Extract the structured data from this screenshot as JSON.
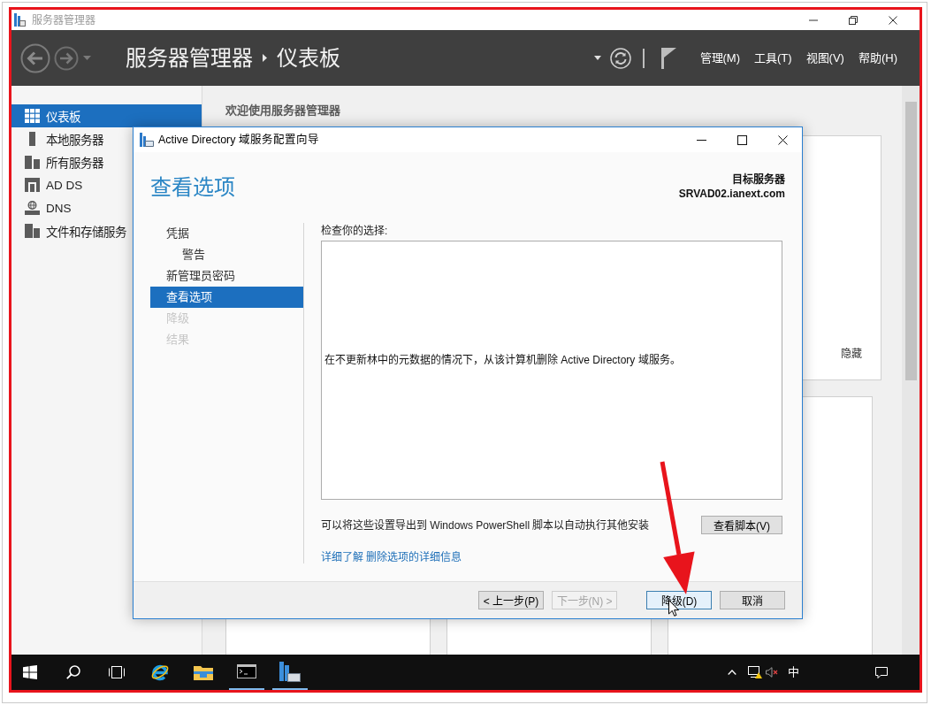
{
  "window": {
    "title": "服务器管理器"
  },
  "header": {
    "breadcrumb": [
      {
        "label": "服务器管理器"
      },
      {
        "label": "仪表板"
      }
    ],
    "menus": [
      "管理(M)",
      "工具(T)",
      "视图(V)",
      "帮助(H)"
    ]
  },
  "sidebar": {
    "items": [
      {
        "label": "仪表板",
        "selected": true
      },
      {
        "label": "本地服务器",
        "selected": false
      },
      {
        "label": "所有服务器",
        "selected": false
      },
      {
        "label": "AD DS",
        "selected": false
      },
      {
        "label": "DNS",
        "selected": false
      },
      {
        "label": "文件和存储服务",
        "selected": false
      }
    ]
  },
  "dashboard": {
    "welcome_heading": "欢迎使用服务器管理器",
    "hide_link": "隐藏"
  },
  "dialog": {
    "title": "Active Directory 域服务配置向导",
    "heading": "查看选项",
    "target_label": "目标服务器",
    "target_server": "SRVAD02.ianext.com",
    "steps": [
      {
        "label": "凭据",
        "selected": false,
        "disabled": false,
        "children": [
          {
            "label": "警告",
            "selected": false,
            "disabled": false
          }
        ]
      },
      {
        "label": "新管理员密码",
        "selected": false,
        "disabled": false
      },
      {
        "label": "查看选项",
        "selected": true,
        "disabled": false
      },
      {
        "label": "降级",
        "selected": false,
        "disabled": true
      },
      {
        "label": "结果",
        "selected": false,
        "disabled": true
      }
    ],
    "review_label": "检查你的选择:",
    "review_text": "在不更新林中的元数据的情况下，从该计算机删除 Active Directory 域服务。",
    "export_note": "可以将这些设置导出到 Windows PowerShell 脚本以自动执行其他安装",
    "view_script_button": "查看脚本(V)",
    "more_info_link": "详细了解 删除选项的详细信息",
    "nav_buttons": [
      {
        "label": "< 上一步(P)",
        "disabled": false
      },
      {
        "label": "下一步(N) >",
        "disabled": true
      }
    ],
    "action_buttons": [
      {
        "label": "降级(D)",
        "default": true
      },
      {
        "label": "取消",
        "default": false
      }
    ]
  },
  "taskbar": {
    "apps": [
      {
        "active": false
      },
      {
        "active": false
      },
      {
        "active": false
      },
      {
        "active": false
      },
      {
        "active": false
      },
      {
        "active": true
      },
      {
        "active": true
      }
    ],
    "input_method": "中"
  }
}
